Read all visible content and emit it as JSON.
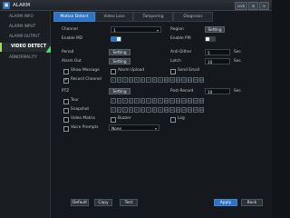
{
  "window": {
    "title": "ALARM",
    "logo": "▣",
    "buttons": [
      "LIVE",
      "⚙",
      "✕"
    ]
  },
  "sidebar": {
    "items": [
      {
        "label": "ALARM INFO",
        "active": false
      },
      {
        "label": "ALARM INPUT",
        "active": false
      },
      {
        "label": "ALARM OUTPUT",
        "active": false
      },
      {
        "label": "VIDEO DETECT",
        "active": true
      },
      {
        "label": "ABNORMALITY",
        "active": false
      }
    ]
  },
  "tabs": [
    {
      "label": "Motion Detect",
      "active": true
    },
    {
      "label": "Video Loss",
      "active": false
    },
    {
      "label": "Tampering",
      "active": false
    },
    {
      "label": "Diagnosis",
      "active": false
    }
  ],
  "form": {
    "channel": {
      "label": "Channel",
      "value": "1"
    },
    "region": {
      "label": "Region",
      "button": "Setting"
    },
    "enable_md": {
      "label": "Enable MD",
      "on": true
    },
    "enable_pir": {
      "label": "Enable PIR",
      "on": false
    },
    "period": {
      "label": "Period",
      "button": "Setting"
    },
    "anti_dither": {
      "label": "Anti-Dither",
      "value": "5",
      "unit": "Sec."
    },
    "alarm_out": {
      "label": "Alarm Out",
      "button": "Setting"
    },
    "latch": {
      "label": "Latch",
      "value": "10",
      "unit": "Sec."
    },
    "show_message": {
      "label": "Show Message",
      "checked": false
    },
    "alarm_upload": {
      "label": "Alarm Upload",
      "checked": false
    },
    "send_email": {
      "label": "Send Email",
      "checked": false
    },
    "record_channel": {
      "label": "Record Channel",
      "checked": true
    },
    "ptz": {
      "label": "PTZ",
      "button": "Setting"
    },
    "post_record": {
      "label": "Post-Record",
      "value": "10",
      "unit": "Sec."
    },
    "tour": {
      "label": "Tour",
      "checked": false
    },
    "snapshot": {
      "label": "Snapshot",
      "checked": false
    },
    "video_matrix": {
      "label": "Video Matrix",
      "checked": false
    },
    "buzzer": {
      "label": "Buzzer",
      "checked": false
    },
    "log": {
      "label": "Log",
      "checked": false
    },
    "voice_prompts": {
      "label": "Voice Prompts",
      "checked": false,
      "value": "None"
    },
    "channel_boxes": [
      "1",
      "2",
      "3",
      "4",
      "5",
      "6",
      "7",
      "8",
      "9",
      "10",
      "11",
      "12",
      "13",
      "14",
      "15",
      "16"
    ]
  },
  "footer": {
    "default": "Default",
    "copy": "Copy",
    "test": "Test",
    "apply": "Apply",
    "back": "Back"
  },
  "colors": {
    "accent": "#2f73c2",
    "pointer": "#4be07a",
    "background": "#111418"
  }
}
